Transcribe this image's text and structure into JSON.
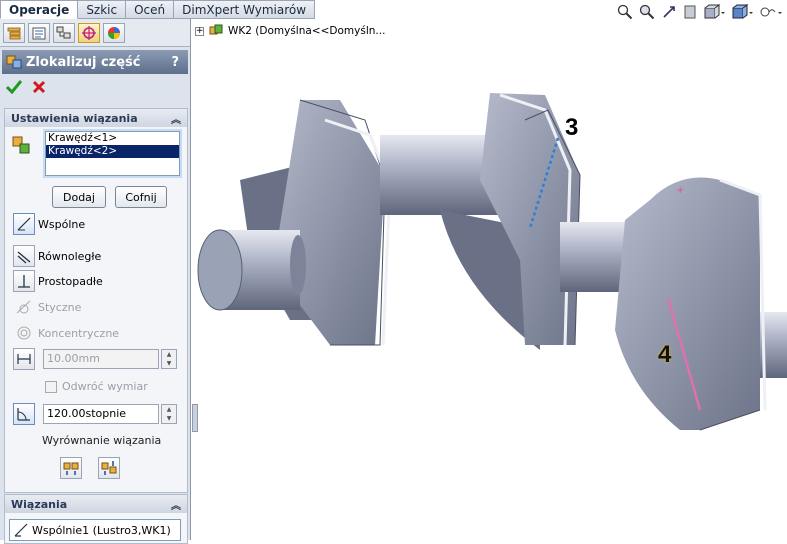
{
  "tabs": [
    {
      "label": "Operacje"
    },
    {
      "label": "Szkic"
    },
    {
      "label": "Oceń"
    },
    {
      "label": "DimXpert Wymiarów"
    }
  ],
  "panel_icons": [
    "feature-manager-icon",
    "property-manager-icon",
    "configuration-manager-icon",
    "dimxpert-manager-icon",
    "appearance-icon"
  ],
  "pm": {
    "title": "Zlokalizuj część",
    "help": "?"
  },
  "mate_settings": {
    "header": "Ustawienia wiązania",
    "selections": [
      "Krawędź<1>",
      "Krawędź<2>"
    ],
    "add_label": "Dodaj",
    "undo_label": "Cofnij",
    "coincident": "Wspólne",
    "parallel": "Równoległe",
    "perpendicular": "Prostopadłe",
    "tangent": "Styczne",
    "concentric": "Koncentryczne",
    "distance": "10.00mm",
    "flip": "Odwróć wymiar",
    "angle": "120.00stopnie",
    "alignment": "Wyrównanie wiązania"
  },
  "mates": {
    "header": "Wiązania",
    "items": [
      "Wspólnie1 (Lustro3,WK1)"
    ]
  },
  "tree": {
    "node": "WK2 (Domyślna<<Domyśln..."
  },
  "callouts": {
    "edge1": "3",
    "edge2": "4"
  },
  "colors": {
    "selection_blue": "#2b7fd6",
    "selection_pink": "#e070b0",
    "part_gray": "#9aa3b8"
  }
}
